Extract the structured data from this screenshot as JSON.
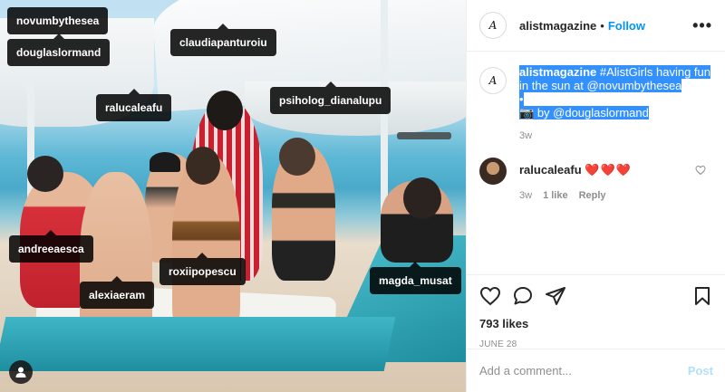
{
  "photo": {
    "tags": [
      "novumbythesea",
      "douglaslormand",
      "claudiapanturoiu",
      "ralucaleafu",
      "psiholog_dianalupu",
      "andreeaesca",
      "roxiipopescu",
      "alexiaeram",
      "magda_musat"
    ],
    "user_tag_icon": "person-icon"
  },
  "header": {
    "avatar_text": "A",
    "username": "alistmagazine",
    "separator": "•",
    "follow_label": "Follow",
    "more_icon": "more-horizontal-icon"
  },
  "caption": {
    "username": "alistmagazine",
    "text": "#AlistGirls having fun in the sun at @novumbythesea",
    "bullet": "•",
    "camera_icon": "📷",
    "credit": "by @douglaslormand",
    "time": "3w"
  },
  "comment": {
    "username": "ralucaleafu",
    "text": "❤️❤️❤️",
    "time": "3w",
    "likes": "1 like",
    "reply_label": "Reply"
  },
  "actions": {
    "likes": "793 likes",
    "date": "JUNE 28"
  },
  "add_comment": {
    "placeholder": "Add a comment...",
    "post_label": "Post"
  },
  "colors": {
    "accent": "#0095f6",
    "selection": "#3390ff",
    "post_disabled": "#b2dffc",
    "heart": "#e0245e"
  }
}
